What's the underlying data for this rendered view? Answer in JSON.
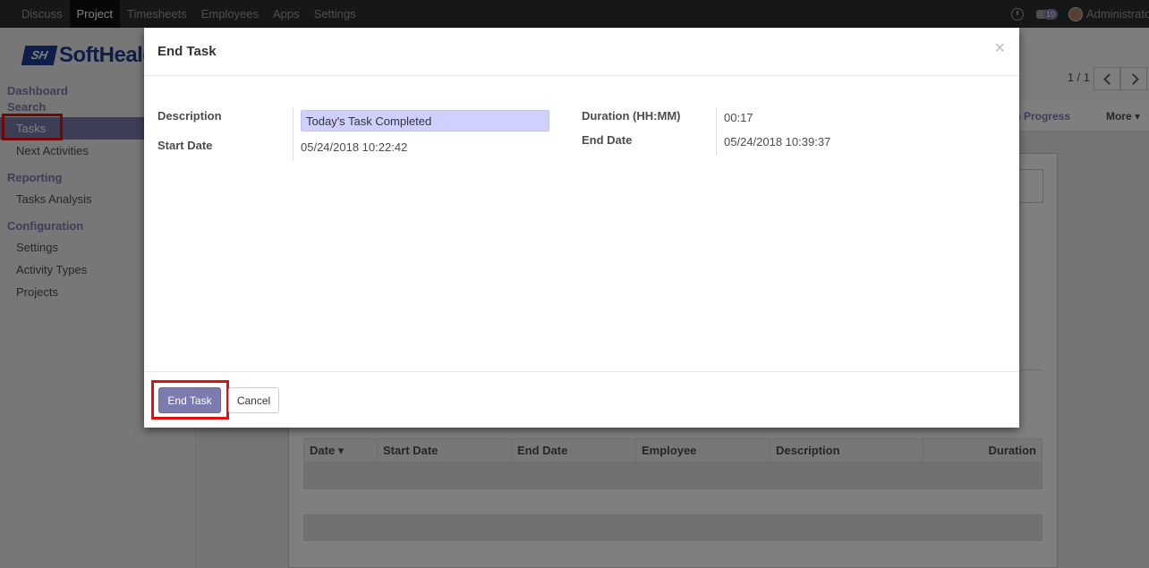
{
  "topnav": {
    "items": [
      "Discuss",
      "Project",
      "Timesheets",
      "Employees",
      "Apps",
      "Settings"
    ],
    "active_index": 1,
    "message_count": "10",
    "user_name": "Administrator"
  },
  "logo": {
    "mark": "SH",
    "text": "SoftHealer"
  },
  "sidebar": {
    "sections": [
      {
        "title": "Dashboard"
      },
      {
        "title": "Search"
      },
      {
        "title": "Reporting"
      },
      {
        "title": "Configuration"
      }
    ],
    "items": [
      "Tasks",
      "Next Activities",
      "Tasks Analysis",
      "Settings",
      "Activity Types",
      "Projects"
    ],
    "active_item": "Tasks"
  },
  "main": {
    "pager": "1 / 1",
    "status_in_progress": "In Progress",
    "more_label": "More ▾",
    "table_headers": [
      "Date ▾",
      "Start Date",
      "End Date",
      "Employee",
      "Description",
      "Duration"
    ]
  },
  "modal": {
    "title": "End Task",
    "close": "×",
    "description_label": "Description",
    "description_value": "Today's Task Completed",
    "start_date_label": "Start Date",
    "start_date_value": "05/24/2018 10:22:42",
    "duration_label": "Duration (HH:MM)",
    "duration_value": "00:17",
    "end_date_label": "End Date",
    "end_date_value": "05/24/2018 10:39:37",
    "end_task_button": "End Task",
    "cancel_button": "Cancel"
  },
  "colors": {
    "accent": "#7c7bad",
    "highlight": "#e01010",
    "navbar": "#2f2f2f"
  }
}
